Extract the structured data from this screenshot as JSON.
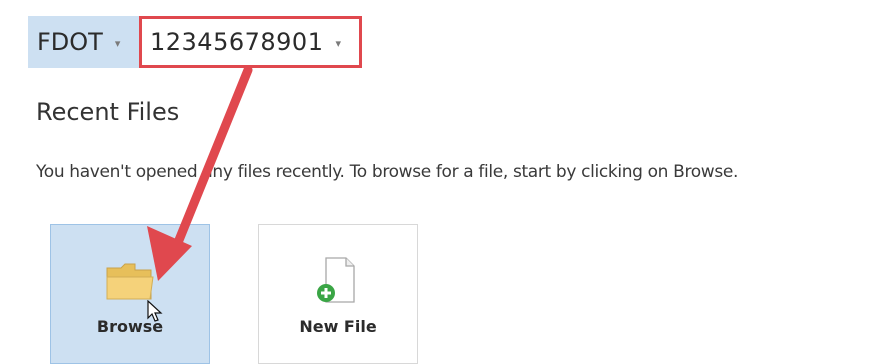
{
  "header": {
    "org_selector": {
      "value": "FDOT",
      "chevron": "▾"
    },
    "project_selector": {
      "value": "12345678901",
      "chevron": "▾"
    }
  },
  "recent_files": {
    "heading": "Recent Files",
    "empty_message": "You haven't opened any files recently.  To browse for a file, start by clicking on Browse."
  },
  "actions": {
    "browse": {
      "label": "Browse",
      "icon": "folder-icon"
    },
    "new_file": {
      "label": "New File",
      "icon": "new-file-icon"
    }
  },
  "annotation": {
    "arrow_color": "#e0484e",
    "highlight_color": "#e0484e"
  },
  "colors": {
    "selected_tile": "#cde0f2",
    "folder": "#f5d27a"
  }
}
